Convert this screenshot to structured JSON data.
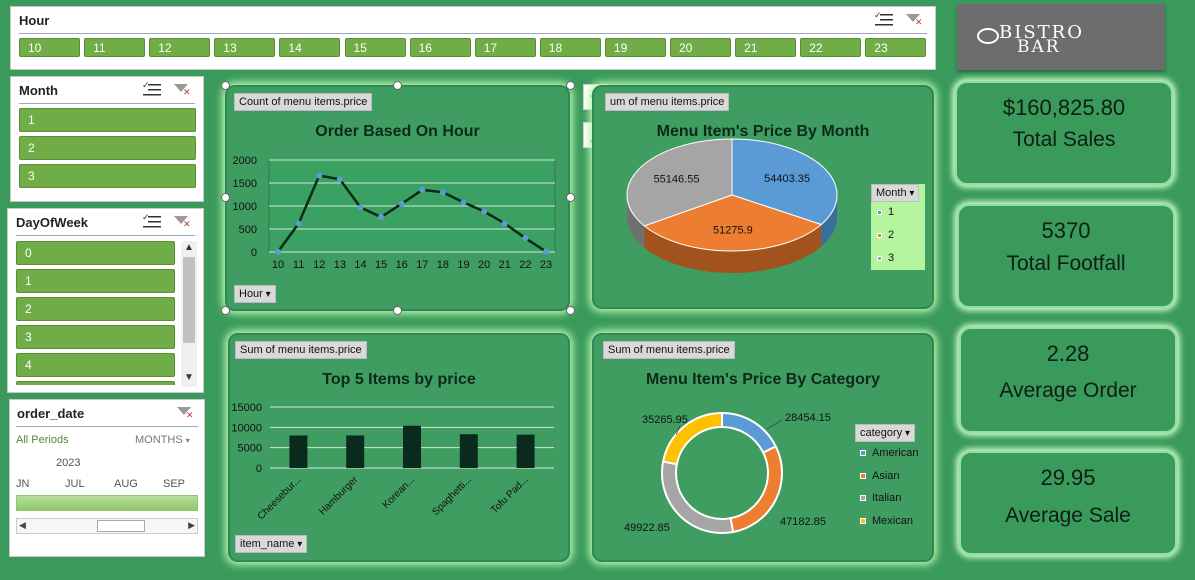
{
  "hour_slicer": {
    "title": "Hour",
    "items": [
      "10",
      "11",
      "12",
      "13",
      "14",
      "15",
      "16",
      "17",
      "18",
      "19",
      "20",
      "21",
      "22",
      "23"
    ]
  },
  "month_slicer": {
    "title": "Month",
    "items": [
      "1",
      "2",
      "3"
    ]
  },
  "dow_slicer": {
    "title": "DayOfWeek",
    "items": [
      "0",
      "1",
      "2",
      "3",
      "4"
    ]
  },
  "date_timeline": {
    "title": "order_date",
    "all_periods": "All Periods",
    "unit": "MONTHS",
    "year": "2023",
    "months": [
      "JN",
      "JUL",
      "AUG",
      "SEP"
    ]
  },
  "logo": {
    "line1": "BISTRO",
    "line2": "BAR"
  },
  "chart_hour": {
    "tag": "Count of menu items.price",
    "field_button": "Hour",
    "icons": [
      "plus-icon",
      "brush-icon"
    ]
  },
  "chart_month": {
    "tag": "Sum of menu items.price",
    "tag_visible": "um of menu items.price",
    "legend_title": "Month"
  },
  "chart_items": {
    "tag": "Sum of menu items.price",
    "field_button": "item_name"
  },
  "chart_category": {
    "tag": "Sum of menu items.price",
    "legend_title": "category"
  },
  "kpis": [
    {
      "value": "$160,825.80",
      "label": "Total Sales"
    },
    {
      "value": "5370",
      "label": "Total Footfall"
    },
    {
      "value": "2.28",
      "label": "Average Order"
    },
    {
      "value": "29.95",
      "label": "Average Sale"
    }
  ],
  "colors": {
    "slicer_button": "#70ad47",
    "line": "#0d2a19",
    "marker": "#5b9bd5",
    "blue": "#5b9bd5",
    "orange": "#ed7d31",
    "gray": "#a5a5a5",
    "yellow": "#ffc000",
    "bar": "#0b2a1e"
  },
  "chart_data": [
    {
      "type": "line",
      "title": "Order Based On Hour",
      "x": [
        "10",
        "11",
        "12",
        "13",
        "14",
        "15",
        "16",
        "17",
        "18",
        "19",
        "20",
        "21",
        "22",
        "23"
      ],
      "series": [
        {
          "values": [
            5,
            620,
            1660,
            1580,
            970,
            760,
            1050,
            1350,
            1300,
            1080,
            880,
            620,
            300,
            10
          ]
        }
      ],
      "ylim": [
        0,
        2000
      ],
      "yticks": [
        "0",
        "500",
        "1000",
        "1500",
        "2000"
      ]
    },
    {
      "type": "pie",
      "title": "Menu Item's Price By Month",
      "categories": [
        "1",
        "2",
        "3"
      ],
      "values": [
        54403.35,
        51275.9,
        55146.55
      ],
      "labels": [
        "54403.35",
        "51275.9",
        "55146.55"
      ]
    },
    {
      "type": "bar",
      "title": "Top 5 Items by price",
      "categories": [
        "Cheesebur...",
        "Hamburger",
        "Korean...",
        "Spaghetti...",
        "Tofu Pad..."
      ],
      "values": [
        8000,
        8000,
        10400,
        8300,
        8200
      ],
      "ylim": [
        0,
        15000
      ],
      "yticks": [
        "0",
        "5000",
        "10000",
        "15000"
      ]
    },
    {
      "type": "pie",
      "title": "Menu Item's Price By Category",
      "categories": [
        "American",
        "Asian",
        "Italian",
        "Mexican"
      ],
      "values": [
        28454.15,
        47182.85,
        49922.85,
        35265.95
      ],
      "labels": [
        "28454.15",
        "47182.85",
        "49922.85",
        "35265.95"
      ]
    }
  ]
}
